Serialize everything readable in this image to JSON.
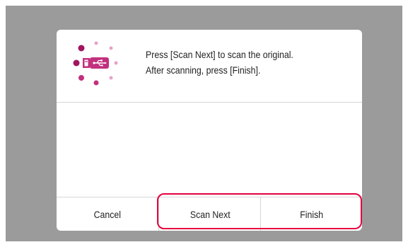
{
  "dialog": {
    "message_line1": "Press [Scan Next] to scan the original.",
    "message_line2": "After scanning, press [Finish].",
    "icon": "usb-memory-scanning-icon"
  },
  "buttons": {
    "cancel": "Cancel",
    "scan_next": "Scan Next",
    "finish": "Finish"
  },
  "colors": {
    "screen_background": "#9b9b9b",
    "icon_accent": "#c2307e",
    "highlight": "#e5003e"
  }
}
